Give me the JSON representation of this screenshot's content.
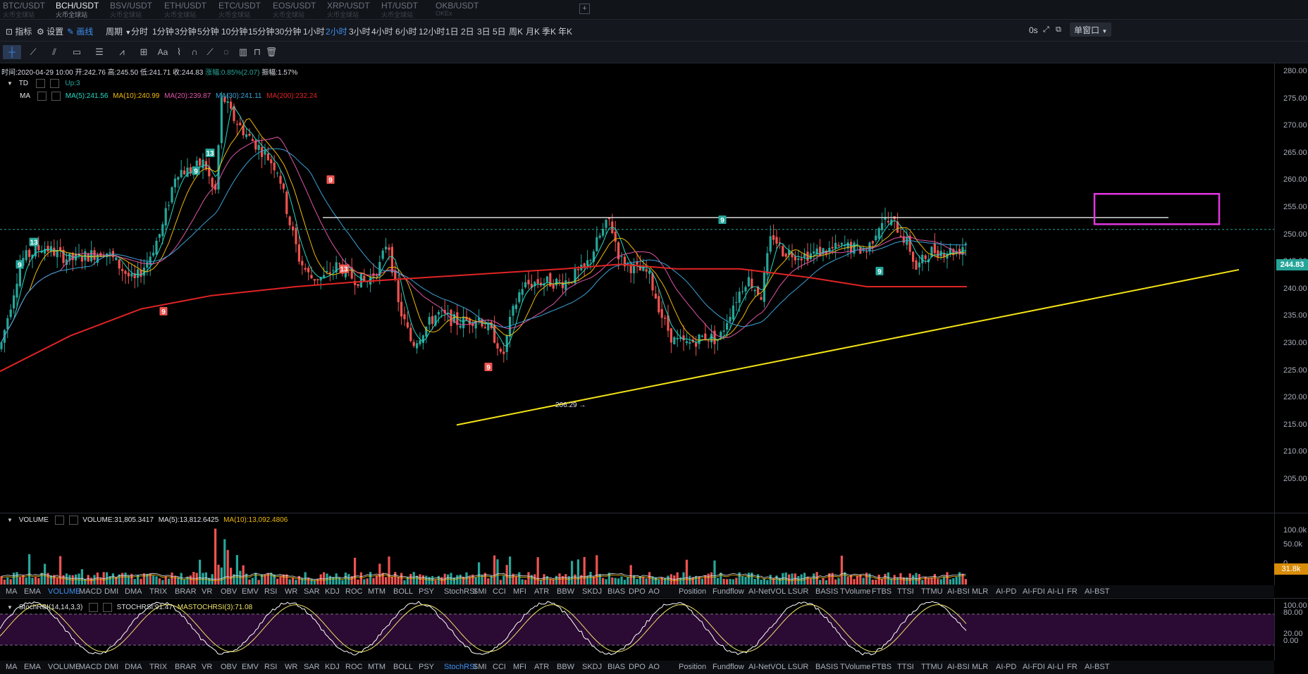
{
  "tabs": [
    {
      "pair": "BTC/USDT",
      "exchange": "火币全球站"
    },
    {
      "pair": "BCH/USDT",
      "exchange": "火币全球站",
      "active": true
    },
    {
      "pair": "BSV/USDT",
      "exchange": "火币全球站"
    },
    {
      "pair": "ETH/USDT",
      "exchange": "火币全球站"
    },
    {
      "pair": "ETC/USDT",
      "exchange": "火币全球站"
    },
    {
      "pair": "EOS/USDT",
      "exchange": "火币全球站"
    },
    {
      "pair": "XRP/USDT",
      "exchange": "火币全球站"
    },
    {
      "pair": "HT/USDT",
      "exchange": "火币全球站"
    },
    {
      "pair": "OKB/USDT",
      "exchange": "OKEx"
    }
  ],
  "toolbar": {
    "indicator_label": "指标",
    "settings_label": "设置",
    "draw_label": "画线",
    "period_label": "周期",
    "intervals": [
      "分时",
      "1分钟",
      "3分钟",
      "5分钟",
      "10分钟",
      "15分钟",
      "30分钟",
      "1小时",
      "2小时",
      "3小时",
      "4小时",
      "6小时",
      "12小时",
      "1日",
      "2日",
      "3日",
      "5日",
      "周K",
      "月K",
      "季K",
      "年K"
    ],
    "active_interval": "2小时",
    "countdown": "0s",
    "window_label": "单窗口"
  },
  "ohlc": {
    "time": "时间:2020-04-29 10:00",
    "open": "开:242.76",
    "high": "高:245.50",
    "low": "低:241.71",
    "close": "收:244.83",
    "change": "涨幅:0.85%(2.07)",
    "amplitude": "振幅:1.57%"
  },
  "td": {
    "name": "TD",
    "value": "Up:3"
  },
  "ma_legend": {
    "name": "MA",
    "ma5": "MA(5):241.56",
    "ma10": "MA(10):240.99",
    "ma20": "MA(20):239.87",
    "ma30": "MA(30):241.11",
    "ma200": "MA(200):232.24"
  },
  "price_axis": [
    "280.00",
    "275.00",
    "270.00",
    "265.00",
    "260.00",
    "255.00",
    "250.00",
    "245.00",
    "240.00",
    "235.00",
    "230.00",
    "225.00",
    "220.00",
    "215.00",
    "210.00",
    "205.00"
  ],
  "current_price": "244.83",
  "low_marker": "206.29",
  "td_markers": [
    {
      "text": "9",
      "type": "buy"
    },
    {
      "text": "13",
      "type": "buy"
    },
    {
      "text": "9",
      "type": "sell"
    },
    {
      "text": "9",
      "type": "buy"
    },
    {
      "text": "13",
      "type": "buy"
    },
    {
      "text": "9",
      "type": "sell"
    },
    {
      "text": "13",
      "type": "sell"
    },
    {
      "text": "9",
      "type": "sell"
    },
    {
      "text": "9",
      "type": "buy"
    },
    {
      "text": "9",
      "type": "buy"
    }
  ],
  "volume": {
    "name": "VOLUME",
    "value": "VOLUME:31,805.3417",
    "ma5": "MA(5):13,812.6425",
    "ma10": "MA(10):13,092.4806",
    "axis": [
      "100.0k",
      "50.0k",
      "0"
    ],
    "current": "31.8k"
  },
  "indicators": [
    "MA",
    "EMA",
    "VOLUME",
    "MACD",
    "DMI",
    "DMA",
    "TRIX",
    "BRAR",
    "VR",
    "OBV",
    "EMV",
    "RSI",
    "WR",
    "SAR",
    "KDJ",
    "ROC",
    "MTM",
    "BOLL",
    "PSY",
    "StochRSI",
    "SMI",
    "CCI",
    "MFI",
    "ATR",
    "BBW",
    "SKDJ",
    "BIAS",
    "DPO",
    "AO",
    "Position",
    "Fundflow",
    "AI-NetVOL",
    "LSUR",
    "BASIS",
    "TVolume",
    "FTBS",
    "TTSI",
    "TTMU",
    "AI-BSI",
    "MLR",
    "AI-PD",
    "AI-FDI",
    "AI-LI",
    "FR",
    "AI-BST"
  ],
  "stochrsi": {
    "name": "StochRSI(14,14,3,3)",
    "value": "STOCHRSI:91.47",
    "ma": "MASTOCHRSI(3):71.08",
    "axis": [
      "100.00",
      "80.00",
      "20.00",
      "0.00"
    ]
  },
  "colors": {
    "up": "#26a69a",
    "down": "#ef5350",
    "ma5": "#26d9c3",
    "ma10": "#f0b90b",
    "ma20": "#e056a8",
    "ma30": "#3aa3d8",
    "ma200": "#e02424",
    "trendline": "#f5e317",
    "box": "#e236e0"
  }
}
